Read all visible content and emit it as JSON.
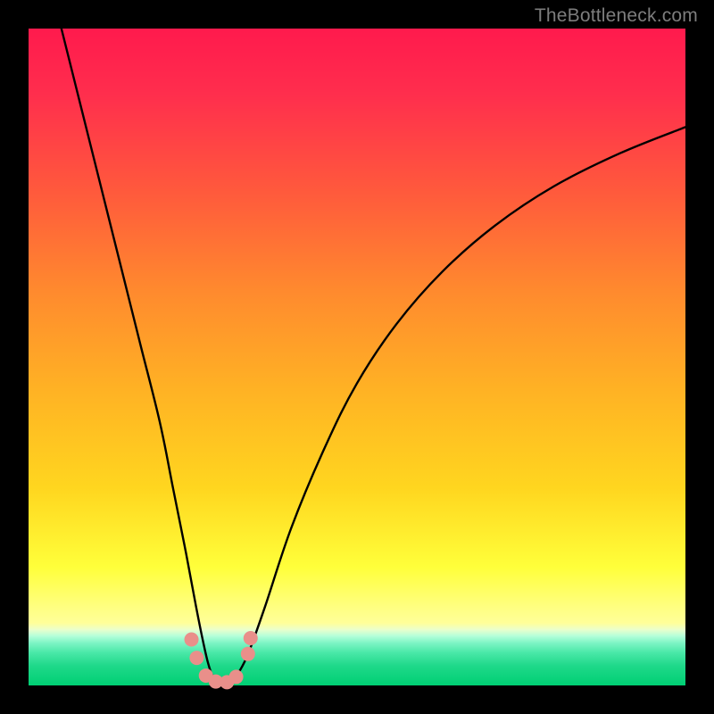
{
  "watermark": "TheBottleneck.com",
  "chart_data": {
    "type": "line",
    "title": "",
    "xlabel": "",
    "ylabel": "",
    "xlim": [
      0,
      100
    ],
    "ylim": [
      0,
      100
    ],
    "grid": false,
    "legend": false,
    "series": [
      {
        "name": "curve",
        "color": "#000000",
        "x": [
          5,
          8,
          11,
          14,
          17,
          20,
          22,
          24,
          25.5,
          26.5,
          27.3,
          28,
          29,
          30,
          31,
          32,
          33.5,
          36,
          40,
          45,
          50,
          56,
          63,
          71,
          80,
          90,
          100
        ],
        "y": [
          100,
          88,
          76,
          64,
          52,
          40,
          30,
          20,
          12,
          7,
          3.5,
          1.5,
          0.5,
          0.3,
          0.8,
          2,
          5,
          12,
          24,
          36,
          46,
          55,
          63,
          70,
          76,
          81,
          85
        ]
      }
    ],
    "markers": [
      {
        "x": 24.8,
        "y": 7.0
      },
      {
        "x": 25.6,
        "y": 4.2
      },
      {
        "x": 27.0,
        "y": 1.5
      },
      {
        "x": 28.5,
        "y": 0.6
      },
      {
        "x": 30.2,
        "y": 0.5
      },
      {
        "x": 31.6,
        "y": 1.3
      },
      {
        "x": 33.4,
        "y": 4.8
      },
      {
        "x": 33.8,
        "y": 7.2
      }
    ],
    "marker_color": "#e98f8a",
    "gradient": {
      "top": "#ff1a4d",
      "mid": "#ffd61f",
      "bottom": "#00cf74"
    }
  }
}
